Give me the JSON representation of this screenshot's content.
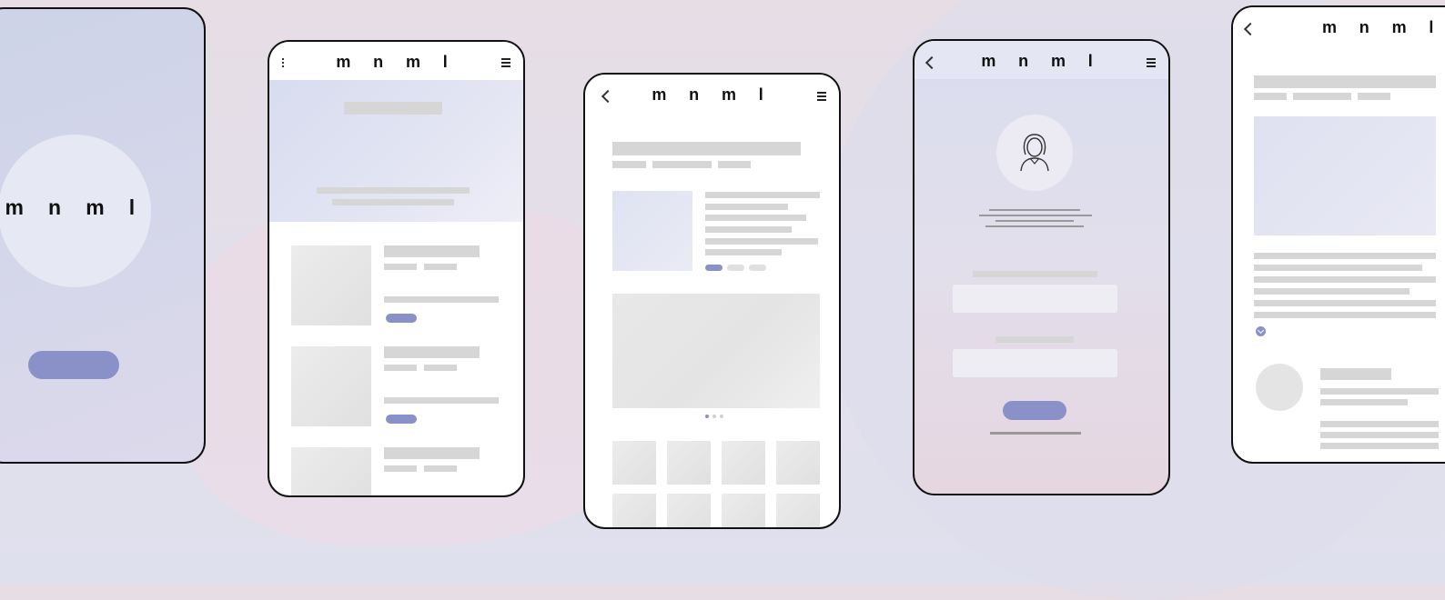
{
  "brand": {
    "logo_text": "m n m l"
  },
  "colors": {
    "accent": "#8a91c8",
    "placeholder": "#d6d6d6",
    "frame": "#111111"
  },
  "icons": {
    "back": "chevron-left-icon",
    "menu": "hamburger-menu-icon",
    "more": "vertical-dots-icon",
    "avatar": "female-user-icon",
    "expand": "chevron-down-circle-icon"
  },
  "screens": [
    {
      "name": "splash",
      "logo_text": "m n m l"
    },
    {
      "name": "list",
      "logo_text": "m n m l"
    },
    {
      "name": "product-detail",
      "logo_text": "m n m l"
    },
    {
      "name": "login",
      "logo_text": "m n m l"
    },
    {
      "name": "article",
      "logo_text": "m n m l"
    }
  ]
}
